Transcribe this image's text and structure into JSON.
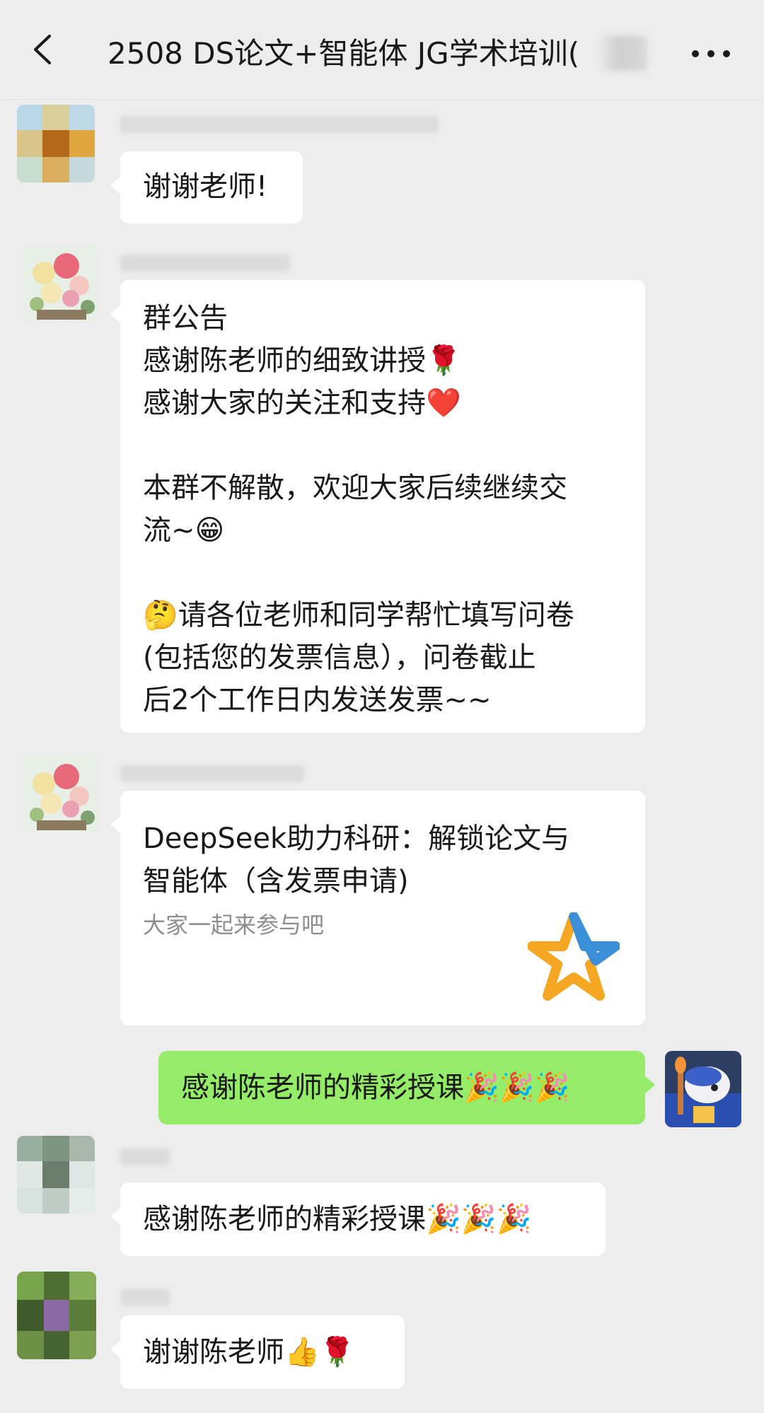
{
  "header": {
    "title": "2508 DS论文+智能体 JG学术培训(",
    "back_icon": "chevron-left-icon",
    "more_icon": "more-horizontal-icon"
  },
  "messages": {
    "m1": {
      "text": "谢谢老师!"
    },
    "m2": {
      "lines": [
        "群公告",
        "感谢陈老师的细致讲授🌹",
        "感谢大家的关注和支持❤️",
        "",
        "本群不解散，欢迎大家后续继续交",
        "流~😁",
        "",
        "🤔请各位老师和同学帮忙填写问卷",
        "(包括您的发票信息），问卷截止",
        "后2个工作日内发送发票~~"
      ]
    },
    "m3": {
      "card_title_line1": "DeepSeek助力科研：解锁论文与",
      "card_title_line2": "智能体（含发票申请)",
      "card_desc": "大家一起来参与吧",
      "logo_icon": "star-logo-icon"
    },
    "m4": {
      "text": "感谢陈老师的精彩授课🎉🎉🎉"
    },
    "m5": {
      "text": "感谢陈老师的精彩授课🎉🎉🎉"
    },
    "m6": {
      "text": "谢谢陈老师👍🌹"
    }
  },
  "colors": {
    "background": "#ededed",
    "bubble_left": "#ffffff",
    "bubble_right": "#95ec69",
    "text": "#191919",
    "secondary_text": "#8e8e8e"
  }
}
